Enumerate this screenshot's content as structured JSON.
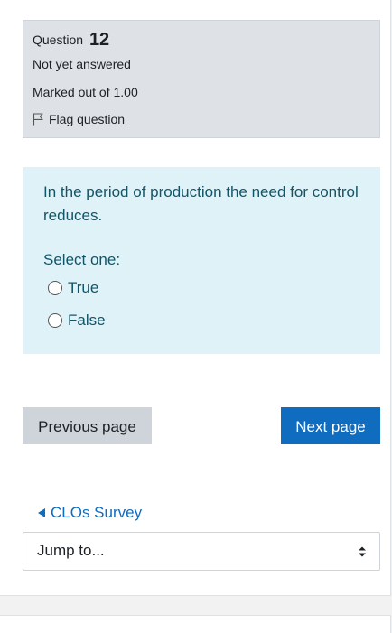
{
  "question_info": {
    "label": "Question",
    "number": "12",
    "state": "Not yet answered",
    "grade": "Marked out of 1.00",
    "flag_label": "Flag question"
  },
  "question": {
    "text": "In the period of production the need for control reduces.",
    "prompt": "Select one:",
    "options": [
      {
        "label": "True"
      },
      {
        "label": "False"
      }
    ]
  },
  "navigation": {
    "previous_label": "Previous page",
    "next_label": "Next page",
    "previous_activity": "CLOs Survey",
    "jump_label": "Jump to..."
  },
  "colors": {
    "info_bg": "#dee2e6",
    "content_bg": "#def2f8",
    "content_text": "#115567",
    "primary": "#0f6cbf",
    "secondary": "#ced4da"
  }
}
